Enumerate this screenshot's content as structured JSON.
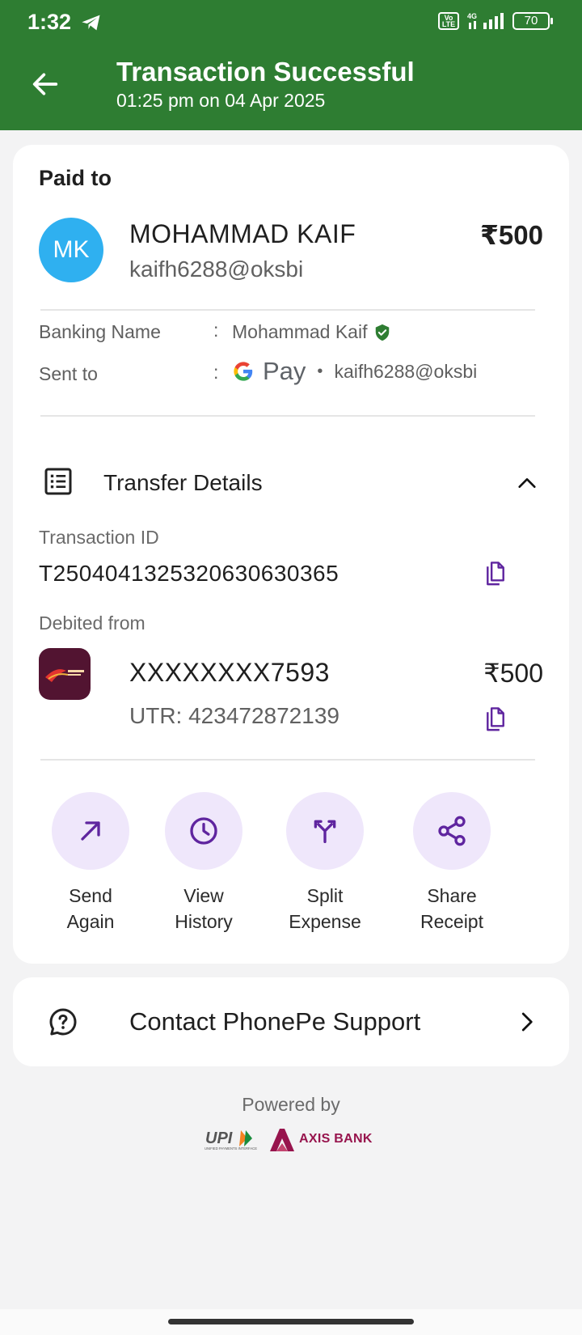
{
  "status_bar": {
    "time": "1:32",
    "network_badge": "Vo LTE",
    "network_type": "4G",
    "battery": "70"
  },
  "header": {
    "title": "Transaction Successful",
    "subtitle": "01:25 pm on 04 Apr 2025",
    "bg_color": "#2e7d32"
  },
  "paid_to": {
    "heading": "Paid to",
    "avatar_initials": "MK",
    "avatar_color": "#2fb0f0",
    "name": "MOHAMMAD  KAIF",
    "vpa": "kaifh6288@oksbi",
    "amount": "₹500"
  },
  "details": {
    "banking_name_label": "Banking Name",
    "banking_name_value": "Mohammad  Kaif",
    "sent_to_label": "Sent to",
    "sent_to_app": "Pay",
    "sent_to_vpa": "kaifh6288@oksbi",
    "colon": ":"
  },
  "transfer": {
    "section_title": "Transfer Details",
    "transaction_id_label": "Transaction ID",
    "transaction_id": "T2504041325320630630365",
    "debited_from_label": "Debited from",
    "account_number": "XXXXXXXX7593",
    "debit_amount": "₹500",
    "utr": "UTR: 423472872139"
  },
  "actions": [
    {
      "line1": "Send",
      "line2": "Again",
      "icon": "arrow-up-right-icon"
    },
    {
      "line1": "View",
      "line2": "History",
      "icon": "clock-icon"
    },
    {
      "line1": "Split",
      "line2": "Expense",
      "icon": "split-icon"
    },
    {
      "line1": "Share",
      "line2": "Receipt",
      "icon": "share-icon"
    }
  ],
  "support": {
    "label": "Contact PhonePe Support"
  },
  "footer": {
    "powered_by": "Powered by",
    "upi_text": "UPI",
    "upi_subtext": "UNIFIED PAYMENTS INTERFACE",
    "bank_name": "AXIS BANK"
  },
  "colors": {
    "accent_purple": "#5f259f",
    "action_bg": "#efe7fb",
    "verified_green": "#2e7d32"
  }
}
